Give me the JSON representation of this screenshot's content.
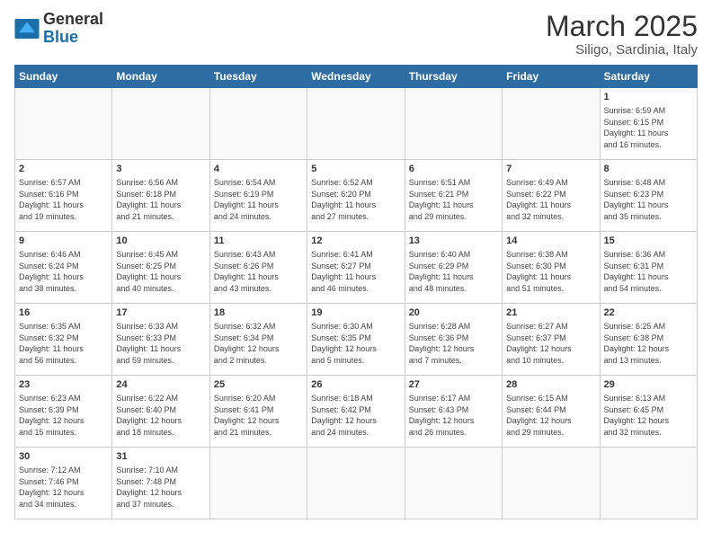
{
  "header": {
    "logo_general": "General",
    "logo_blue": "Blue",
    "month_title": "March 2025",
    "location": "Siligo, Sardinia, Italy"
  },
  "weekdays": [
    "Sunday",
    "Monday",
    "Tuesday",
    "Wednesday",
    "Thursday",
    "Friday",
    "Saturday"
  ],
  "weeks": [
    [
      {
        "day": "",
        "info": ""
      },
      {
        "day": "",
        "info": ""
      },
      {
        "day": "",
        "info": ""
      },
      {
        "day": "",
        "info": ""
      },
      {
        "day": "",
        "info": ""
      },
      {
        "day": "",
        "info": ""
      },
      {
        "day": "1",
        "info": "Sunrise: 6:59 AM\nSunset: 6:15 PM\nDaylight: 11 hours\nand 16 minutes."
      }
    ],
    [
      {
        "day": "2",
        "info": "Sunrise: 6:57 AM\nSunset: 6:16 PM\nDaylight: 11 hours\nand 19 minutes."
      },
      {
        "day": "3",
        "info": "Sunrise: 6:56 AM\nSunset: 6:18 PM\nDaylight: 11 hours\nand 21 minutes."
      },
      {
        "day": "4",
        "info": "Sunrise: 6:54 AM\nSunset: 6:19 PM\nDaylight: 11 hours\nand 24 minutes."
      },
      {
        "day": "5",
        "info": "Sunrise: 6:52 AM\nSunset: 6:20 PM\nDaylight: 11 hours\nand 27 minutes."
      },
      {
        "day": "6",
        "info": "Sunrise: 6:51 AM\nSunset: 6:21 PM\nDaylight: 11 hours\nand 29 minutes."
      },
      {
        "day": "7",
        "info": "Sunrise: 6:49 AM\nSunset: 6:22 PM\nDaylight: 11 hours\nand 32 minutes."
      },
      {
        "day": "8",
        "info": "Sunrise: 6:48 AM\nSunset: 6:23 PM\nDaylight: 11 hours\nand 35 minutes."
      }
    ],
    [
      {
        "day": "9",
        "info": "Sunrise: 6:46 AM\nSunset: 6:24 PM\nDaylight: 11 hours\nand 38 minutes."
      },
      {
        "day": "10",
        "info": "Sunrise: 6:45 AM\nSunset: 6:25 PM\nDaylight: 11 hours\nand 40 minutes."
      },
      {
        "day": "11",
        "info": "Sunrise: 6:43 AM\nSunset: 6:26 PM\nDaylight: 11 hours\nand 43 minutes."
      },
      {
        "day": "12",
        "info": "Sunrise: 6:41 AM\nSunset: 6:27 PM\nDaylight: 11 hours\nand 46 minutes."
      },
      {
        "day": "13",
        "info": "Sunrise: 6:40 AM\nSunset: 6:29 PM\nDaylight: 11 hours\nand 48 minutes."
      },
      {
        "day": "14",
        "info": "Sunrise: 6:38 AM\nSunset: 6:30 PM\nDaylight: 11 hours\nand 51 minutes."
      },
      {
        "day": "15",
        "info": "Sunrise: 6:36 AM\nSunset: 6:31 PM\nDaylight: 11 hours\nand 54 minutes."
      }
    ],
    [
      {
        "day": "16",
        "info": "Sunrise: 6:35 AM\nSunset: 6:32 PM\nDaylight: 11 hours\nand 56 minutes."
      },
      {
        "day": "17",
        "info": "Sunrise: 6:33 AM\nSunset: 6:33 PM\nDaylight: 11 hours\nand 59 minutes."
      },
      {
        "day": "18",
        "info": "Sunrise: 6:32 AM\nSunset: 6:34 PM\nDaylight: 12 hours\nand 2 minutes."
      },
      {
        "day": "19",
        "info": "Sunrise: 6:30 AM\nSunset: 6:35 PM\nDaylight: 12 hours\nand 5 minutes."
      },
      {
        "day": "20",
        "info": "Sunrise: 6:28 AM\nSunset: 6:36 PM\nDaylight: 12 hours\nand 7 minutes."
      },
      {
        "day": "21",
        "info": "Sunrise: 6:27 AM\nSunset: 6:37 PM\nDaylight: 12 hours\nand 10 minutes."
      },
      {
        "day": "22",
        "info": "Sunrise: 6:25 AM\nSunset: 6:38 PM\nDaylight: 12 hours\nand 13 minutes."
      }
    ],
    [
      {
        "day": "23",
        "info": "Sunrise: 6:23 AM\nSunset: 6:39 PM\nDaylight: 12 hours\nand 15 minutes."
      },
      {
        "day": "24",
        "info": "Sunrise: 6:22 AM\nSunset: 6:40 PM\nDaylight: 12 hours\nand 18 minutes."
      },
      {
        "day": "25",
        "info": "Sunrise: 6:20 AM\nSunset: 6:41 PM\nDaylight: 12 hours\nand 21 minutes."
      },
      {
        "day": "26",
        "info": "Sunrise: 6:18 AM\nSunset: 6:42 PM\nDaylight: 12 hours\nand 24 minutes."
      },
      {
        "day": "27",
        "info": "Sunrise: 6:17 AM\nSunset: 6:43 PM\nDaylight: 12 hours\nand 26 minutes."
      },
      {
        "day": "28",
        "info": "Sunrise: 6:15 AM\nSunset: 6:44 PM\nDaylight: 12 hours\nand 29 minutes."
      },
      {
        "day": "29",
        "info": "Sunrise: 6:13 AM\nSunset: 6:45 PM\nDaylight: 12 hours\nand 32 minutes."
      }
    ],
    [
      {
        "day": "30",
        "info": "Sunrise: 7:12 AM\nSunset: 7:46 PM\nDaylight: 12 hours\nand 34 minutes."
      },
      {
        "day": "31",
        "info": "Sunrise: 7:10 AM\nSunset: 7:48 PM\nDaylight: 12 hours\nand 37 minutes."
      },
      {
        "day": "",
        "info": ""
      },
      {
        "day": "",
        "info": ""
      },
      {
        "day": "",
        "info": ""
      },
      {
        "day": "",
        "info": ""
      },
      {
        "day": "",
        "info": ""
      }
    ]
  ]
}
